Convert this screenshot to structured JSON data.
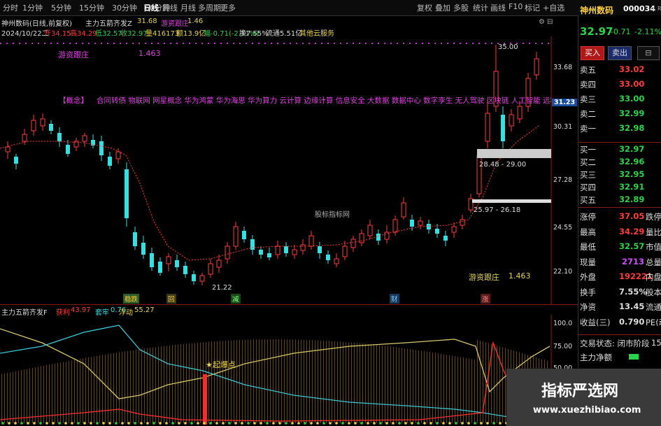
{
  "toolbar": {
    "periods": [
      "分时",
      "1分钟",
      "5分钟",
      "15分钟",
      "30分钟",
      "60分钟",
      "日线",
      "周线",
      "月线",
      "多周期",
      "更多"
    ],
    "active_period": "日线",
    "tools": [
      "复权",
      "叠加",
      "多股",
      "统计",
      "画线",
      "F10",
      "标记",
      "+自选",
      "返回"
    ]
  },
  "header": {
    "stock_line": "神州数码(日线,前复权)",
    "indicator_name": "主力五箭齐发Z",
    "indicator_val": "31.68",
    "indicator_label": "游资跟庄",
    "indicator_label_val": "1.46",
    "quote_line": "2024/10/22二",
    "open": "开34.15",
    "high": "高34.29",
    "low": "低32.57",
    "close": "收32.97",
    "volume": "量416173",
    "amount": "额13.9亿",
    "change": "幅-0.71(-2.11%)",
    "turnover": "换7.55%",
    "float_mv": "流通5.51亿",
    "other": "其他云服务"
  },
  "chart_labels": {
    "follow_label": "游资跟庄",
    "follow_val": "1.463",
    "concept_tag": "【概念】",
    "concepts": "合同转债 物联网 网星概念 华为鸿蒙 华为海思 华为算力 云计算 边缘计算 信息安全 大数据 数据中心 数字孪生 无人驾驶 区块链 人工智能 远程办公 信创 东数西算 Chat",
    "watermark_mid": "股标指标网",
    "high_mark": "35.00",
    "low_mark": "21.22",
    "zone_upper": "28.48 - 29.00",
    "zone_lower": "25.97 - 26.18",
    "bottom_follow_label": "游资跟庄",
    "bottom_follow_val": "1.463",
    "events": [
      "稳跌",
      "回",
      "减",
      "财",
      "涨"
    ]
  },
  "price_axis": [
    "33.68",
    "31.23",
    "30.31",
    "27.28",
    "24.55",
    "22.10"
  ],
  "current_price_tag": "31.23",
  "sub": {
    "name": "主力五箭齐发F",
    "t1": "获利",
    "v1": "43.97",
    "t2": "套牢",
    "v2": "0.76",
    "t3": "浮动",
    "v3": "55.27",
    "start_label": "起爆点",
    "axis": [
      "100.0",
      "75.00",
      "50.00"
    ]
  },
  "right_panel": {
    "name": "神州数码",
    "code": "000034",
    "mark": "L R",
    "price": "32.97",
    "chg": "-0.71",
    "pct": "-2.11%",
    "buy_btn": "买入",
    "sell_btn": "卖出",
    "asks": [
      {
        "label": "卖五",
        "price": "33.02"
      },
      {
        "label": "卖四",
        "price": "33.00"
      },
      {
        "label": "卖三",
        "price": "33.00"
      },
      {
        "label": "卖二",
        "price": "32.99"
      },
      {
        "label": "卖一",
        "price": "32.98"
      }
    ],
    "bids": [
      {
        "label": "买一",
        "price": "32.97"
      },
      {
        "label": "买二",
        "price": "32.96"
      },
      {
        "label": "买三",
        "price": "32.95"
      },
      {
        "label": "买四",
        "price": "32.91"
      },
      {
        "label": "买五",
        "price": "32.89"
      }
    ],
    "stats": [
      {
        "label": "涨停",
        "value": "37.05",
        "label2": "跌停"
      },
      {
        "label": "最高",
        "value": "34.29",
        "label2": "量比"
      },
      {
        "label": "最低",
        "value": "32.57",
        "label2": "市值"
      },
      {
        "label": "现量",
        "value": "2713",
        "label2": "总量"
      },
      {
        "label": "外盘",
        "value": "192221",
        "label2": "内盘"
      },
      {
        "label": "换手",
        "value": "7.55%",
        "label2": "股本"
      },
      {
        "label": "净资",
        "value": "13.45",
        "label2": "流通"
      },
      {
        "label": "收益(三)",
        "value": "0.790",
        "label2": "PE(动)"
      }
    ],
    "trade_state": "交易状态: 闭市阶段",
    "trade_state_num": "15",
    "net_flow": "主力净额"
  },
  "watermark": {
    "title": "指标严选网",
    "url": "www.xuezhibiao.com"
  },
  "colors": {
    "up": "#ff3b3b",
    "down": "#35e0e0",
    "ma": "#ff3b3b",
    "bg": "#000000"
  }
}
